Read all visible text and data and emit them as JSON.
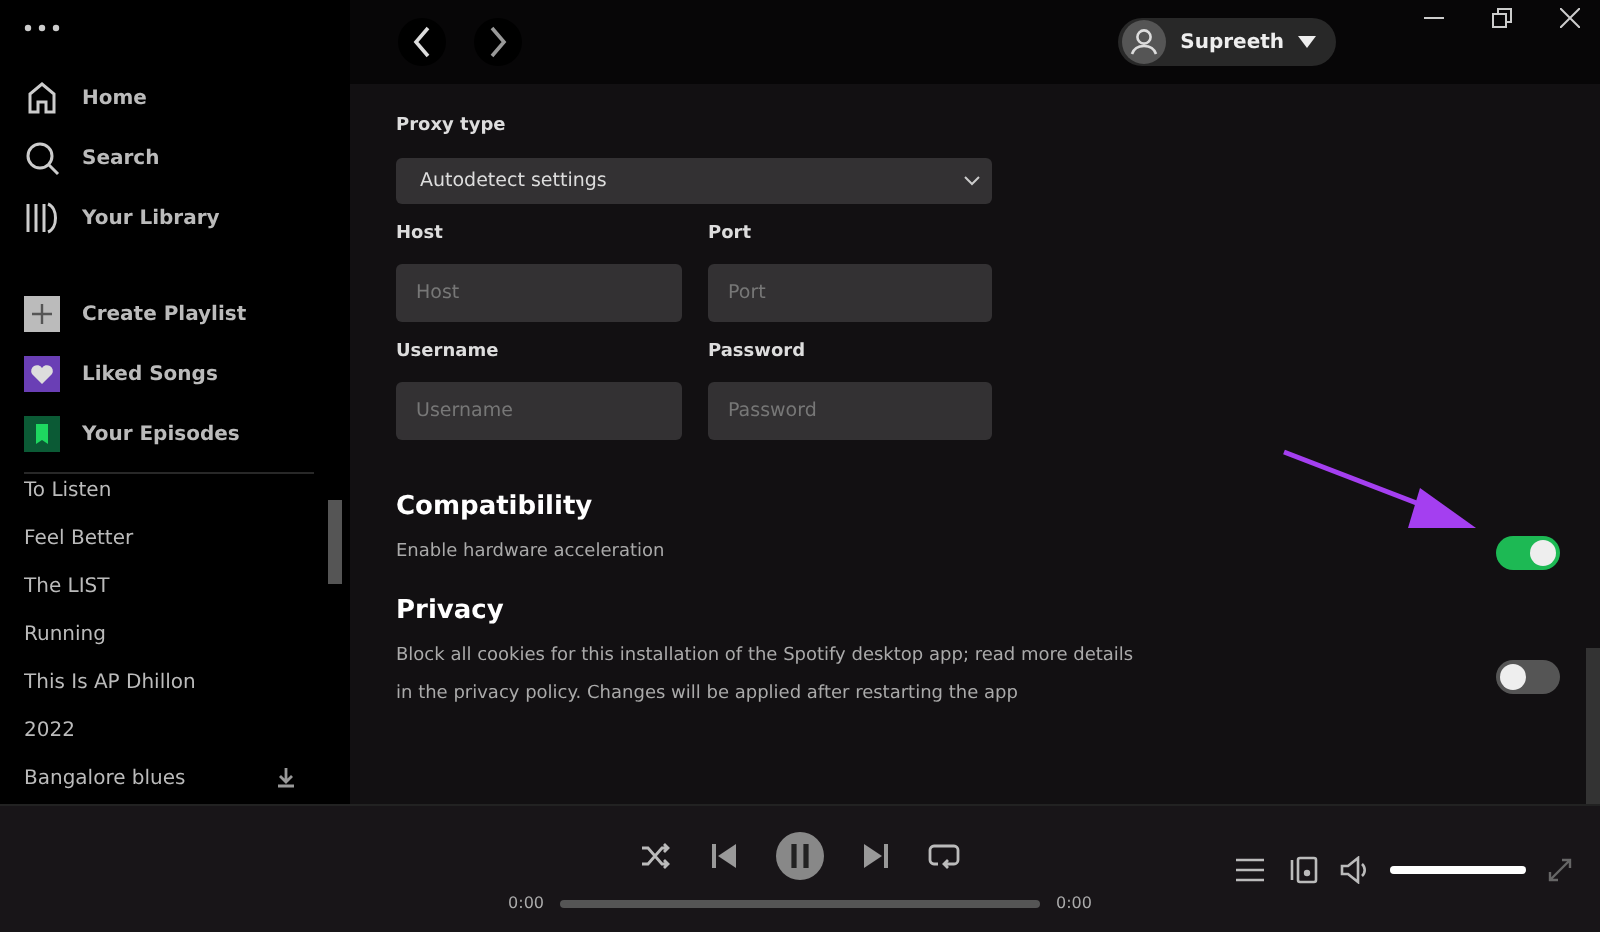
{
  "sidebar": {
    "nav": [
      {
        "kind": "home",
        "label": "Home",
        "selected": false
      },
      {
        "kind": "search",
        "label": "Search",
        "selected": false
      },
      {
        "kind": "library",
        "label": "Your Library",
        "selected": false
      }
    ],
    "actions": [
      {
        "kind": "create",
        "label": "Create Playlist"
      },
      {
        "kind": "liked",
        "label": "Liked Songs"
      },
      {
        "kind": "episodes",
        "label": "Your Episodes"
      }
    ],
    "playlists": [
      {
        "name": "To Listen",
        "downloaded": false
      },
      {
        "name": "Feel Better",
        "downloaded": false
      },
      {
        "name": "The LIST",
        "downloaded": false
      },
      {
        "name": "Running",
        "downloaded": false
      },
      {
        "name": "This Is AP Dhillon",
        "downloaded": false
      },
      {
        "name": "2022",
        "downloaded": false
      },
      {
        "name": "Bangalore blues",
        "downloaded": true
      }
    ]
  },
  "top_bar": {
    "user": "Supreeth"
  },
  "proxy": {
    "type_label": "Proxy type",
    "type_value": "Autodetect settings",
    "fields": [
      {
        "label": "Host",
        "placeholder": "Host"
      },
      {
        "label": "Port",
        "placeholder": "Port"
      },
      {
        "label": "Username",
        "placeholder": "Username"
      },
      {
        "label": "Password",
        "placeholder": "Password"
      }
    ]
  },
  "sections": [
    {
      "title": "Compatibility",
      "description": "Enable hardware acceleration",
      "on": true,
      "highlighted": true
    },
    {
      "title": "Privacy",
      "description": "Block all cookies for this installation of the Spotify desktop app; read more details in the privacy policy. Changes will be applied after restarting the app",
      "on": false,
      "highlighted": false
    }
  ],
  "player": {
    "elapsed": "0:00",
    "duration": "0:00",
    "progress": {
      "level": 0
    },
    "volume": {
      "level": 1
    }
  }
}
